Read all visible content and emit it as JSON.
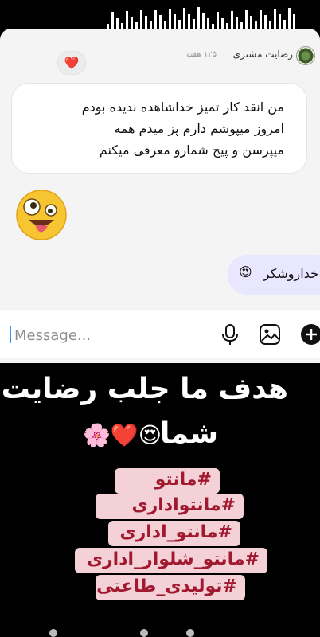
{
  "conversation": {
    "username": "رضایت مشتری",
    "time_ago": "۱۲۵ هفته",
    "reaction": "❤️",
    "incoming_message_lines": [
      "من انقد کار تمیز خداشاهده ندیده بودم",
      "امروز میپوشم دارم پز میدم همه",
      "میپرسن و پیج شمارو معرفی میکنم"
    ],
    "sticker_emoji": "🤪",
    "outgoing_message": "خداروشکر",
    "outgoing_emoji": "😍"
  },
  "composer": {
    "placeholder": "Message...",
    "icons": [
      "microphone-icon",
      "gallery-icon",
      "plus-icon"
    ]
  },
  "story": {
    "headline_line1": "هدف ما جلب رضایت",
    "headline_line2": "شما",
    "headline_emojis": "😍❤️🌸",
    "hashtags": [
      "#مانتو",
      "#مانتواداری",
      "#مانتو_اداری",
      "#مانتو_شلوار_اداری",
      "#تولیدی_طاعتی"
    ]
  },
  "colors": {
    "tag_bg": "#f3d1d7",
    "tag_text": "#a0192f",
    "outgoing_bubble": "#e9e6ff",
    "accent": "#3897f0"
  }
}
